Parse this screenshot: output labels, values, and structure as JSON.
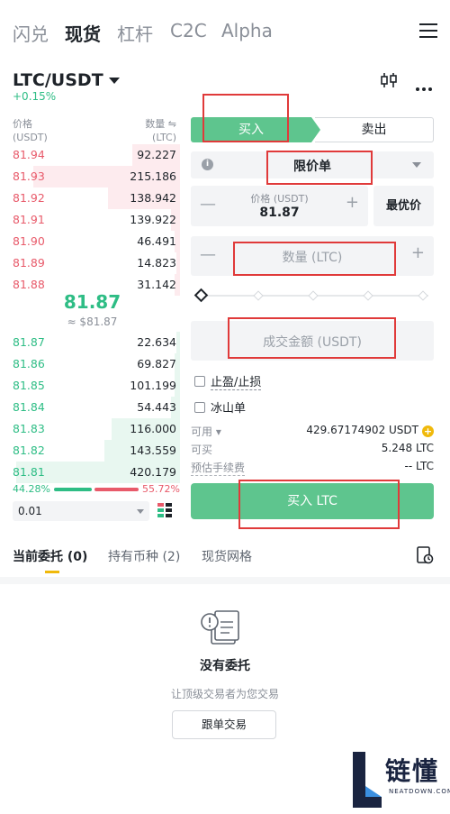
{
  "top_tabs": [
    "闪兑",
    "现货",
    "杠杆",
    "C2C",
    "Alpha"
  ],
  "pair": "LTC/USDT",
  "change": "+0.15%",
  "orderbook": {
    "price_header": "价格",
    "price_unit": "(USDT)",
    "qty_header": "数量 ⇋",
    "qty_unit": "(LTC)",
    "asks": [
      {
        "price": "81.94",
        "qty": "92.227",
        "depth": 0.28
      },
      {
        "price": "81.93",
        "qty": "215.186",
        "depth": 0.86
      },
      {
        "price": "81.92",
        "qty": "138.942",
        "depth": 0.42
      },
      {
        "price": "81.91",
        "qty": "139.922",
        "depth": 0.05
      },
      {
        "price": "81.90",
        "qty": "46.491",
        "depth": 0.03
      },
      {
        "price": "81.89",
        "qty": "14.823",
        "depth": 0.02
      },
      {
        "price": "81.88",
        "qty": "31.142",
        "depth": 0.03
      }
    ],
    "mid_price": "81.87",
    "mid_usd": "≈ $81.87",
    "bids": [
      {
        "price": "81.87",
        "qty": "22.634",
        "depth": 0.02
      },
      {
        "price": "81.86",
        "qty": "69.827",
        "depth": 0.03
      },
      {
        "price": "81.85",
        "qty": "101.199",
        "depth": 0.03
      },
      {
        "price": "81.84",
        "qty": "54.443",
        "depth": 0.05
      },
      {
        "price": "81.83",
        "qty": "116.000",
        "depth": 0.4
      },
      {
        "price": "81.82",
        "qty": "143.559",
        "depth": 0.44
      },
      {
        "price": "81.81",
        "qty": "420.179",
        "depth": 0.96
      }
    ],
    "buy_ratio": "44.28%",
    "sell_ratio": "55.72%",
    "buy_ratio_value": 0.4428,
    "depth_step": "0.01"
  },
  "trade": {
    "buy_tab": "买入",
    "sell_tab": "卖出",
    "order_type": "限价单",
    "price_label": "价格 (USDT)",
    "price_value": "81.87",
    "best_price": "最优价",
    "qty_placeholder": "数量 (LTC)",
    "total_placeholder": "成交金额 (USDT)",
    "tp_sl": "止盈/止损",
    "iceberg": "冰山单",
    "available_label": "可用",
    "available_value": "429.67174902 USDT",
    "can_buy_label": "可买",
    "can_buy_value": "5.248 LTC",
    "fee_label": "预估手续费",
    "fee_value": "-- LTC",
    "buy_button": "买入 LTC"
  },
  "bottom_tabs": [
    "当前委托 (0)",
    "持有币种 (2)",
    "现货网格"
  ],
  "empty": {
    "title": "没有委托",
    "subtitle": "让顶级交易者为您交易",
    "button": "跟单交易"
  },
  "watermark": {
    "text": "链懂",
    "sub": "NEATDOWN.COM"
  },
  "colors": {
    "buy_green": "#5ec58e",
    "bid_green": "#2ebd85",
    "ask_red": "#e85a6a",
    "highlight_red": "#e03a3a",
    "accent_yellow": "#f0b90b"
  }
}
